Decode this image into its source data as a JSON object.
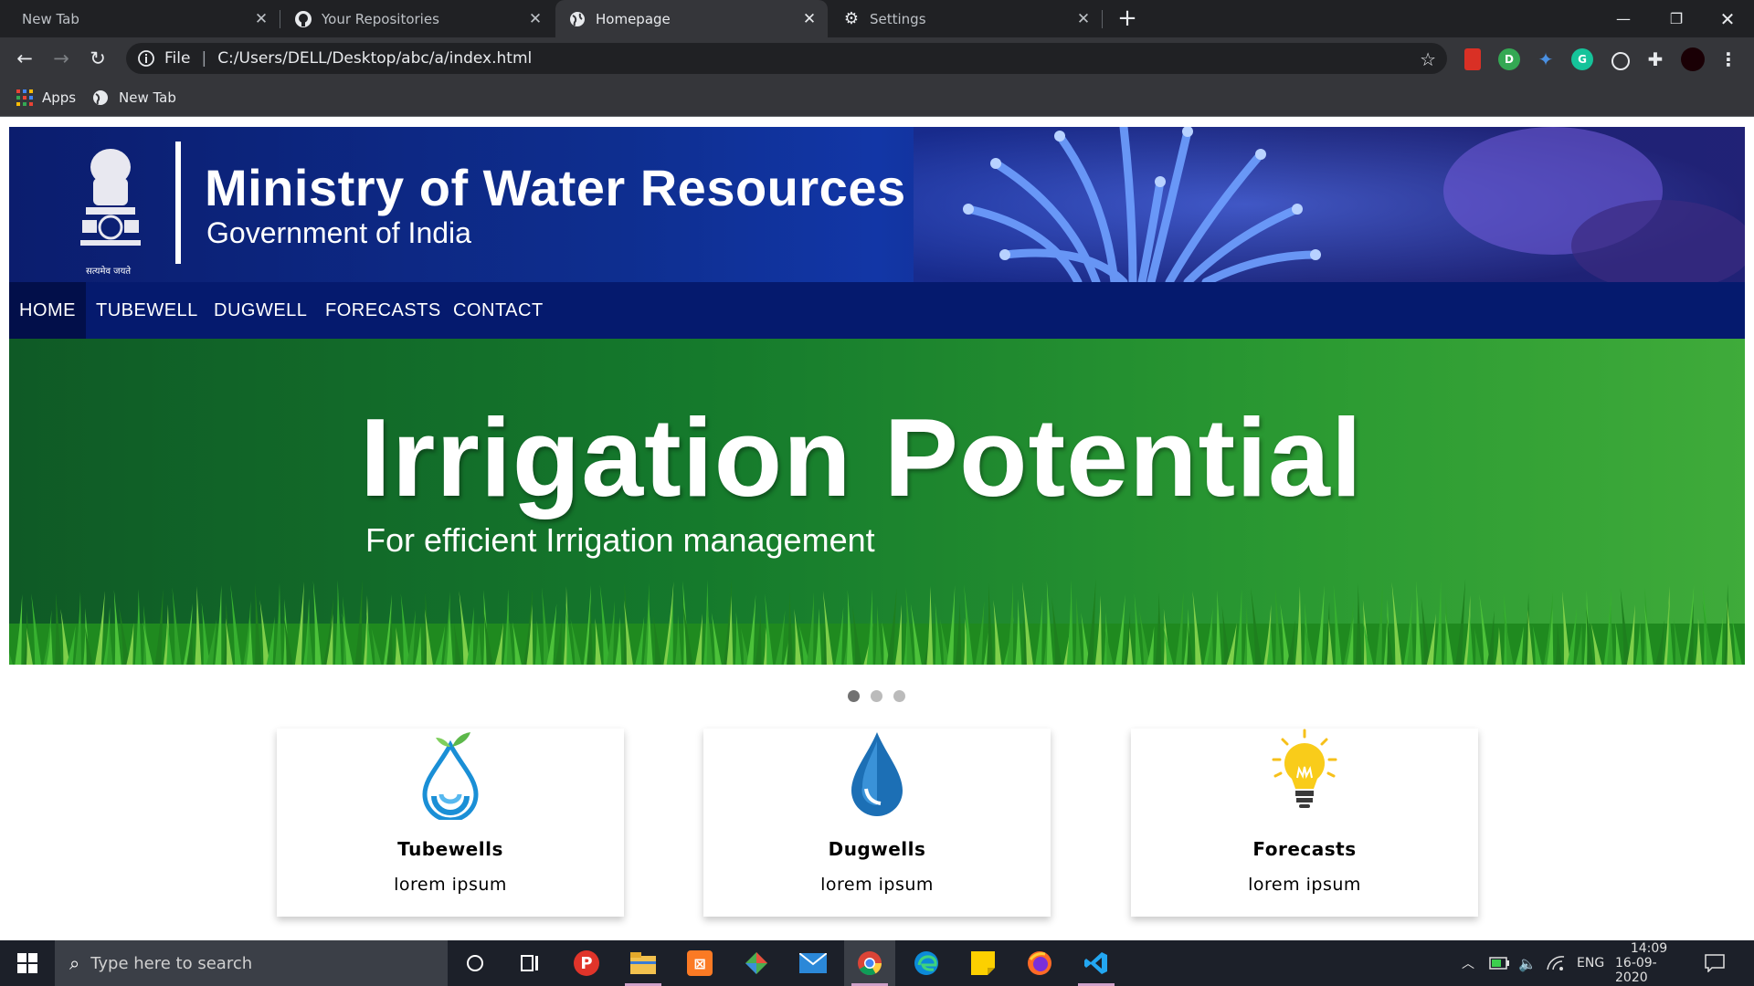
{
  "browser": {
    "tabs": [
      {
        "label": "New Tab",
        "active": false
      },
      {
        "label": "Your Repositories",
        "active": false
      },
      {
        "label": "Homepage",
        "active": true
      },
      {
        "label": "Settings",
        "active": false
      }
    ],
    "omnibox": {
      "scheme_label": "File",
      "url": "C:/Users/DELL/Desktop/abc/a/index.html"
    },
    "bookmarks": [
      {
        "label": "Apps"
      },
      {
        "label": "New Tab"
      }
    ]
  },
  "site": {
    "header": {
      "title": "Ministry of Water Resources",
      "subtitle": "Government of India",
      "emblem_caption": "सत्यमेव जयते"
    },
    "nav": [
      {
        "label": "HOME",
        "active": true
      },
      {
        "label": "TUBEWELL"
      },
      {
        "label": "DUGWELL"
      },
      {
        "label": "FORECASTS"
      },
      {
        "label": "CONTACT"
      }
    ],
    "banner": {
      "title": "Irrigation Potential",
      "subtitle": "For efficient Irrigation management",
      "slide_count": 3,
      "active_slide": 1
    },
    "cards": [
      {
        "title": "Tubewells",
        "desc": "lorem ipsum",
        "icon": "water-drop-leaf-icon"
      },
      {
        "title": "Dugwells",
        "desc": "lorem ipsum",
        "icon": "water-drop-icon"
      },
      {
        "title": "Forecasts",
        "desc": "lorem ipsum",
        "icon": "lightbulb-icon"
      }
    ]
  },
  "taskbar": {
    "search_placeholder": "Type here to search",
    "language": "ENG",
    "time": "14:09",
    "date": "16-09-2020"
  },
  "colors": {
    "header_blue": "#0e2e8f",
    "nav_blue": "#051a6e",
    "banner_green": "#157a2c",
    "chrome_dark": "#202124"
  }
}
